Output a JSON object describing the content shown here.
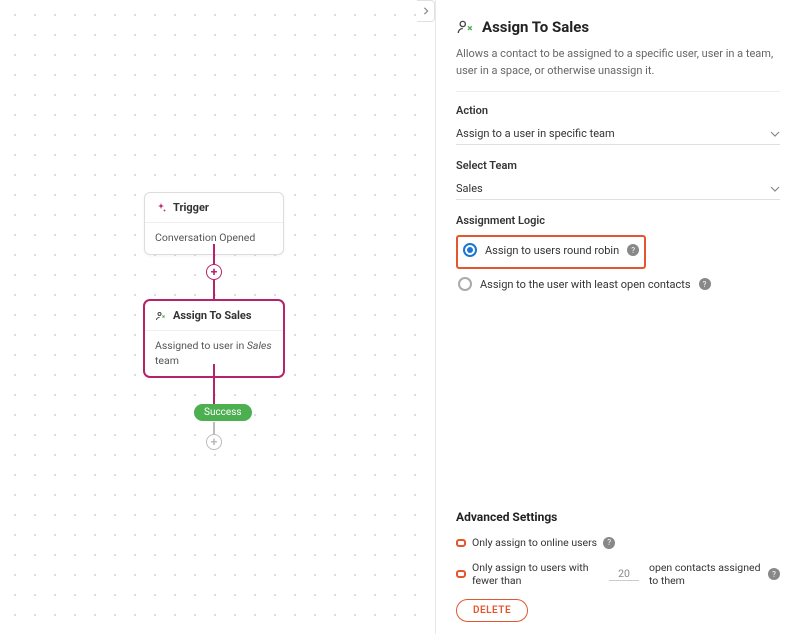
{
  "panel": {
    "title": "Assign To Sales",
    "description": "Allows a contact to be assigned to a specific user, user in a team, user in a space, or otherwise unassign it.",
    "action_label": "Action",
    "action_value": "Assign to a user in specific team",
    "team_label": "Select Team",
    "team_value": "Sales",
    "logic_label": "Assignment Logic",
    "logic_options": {
      "round_robin": "Assign to users round robin",
      "least_open": "Assign to the user with least open contacts"
    },
    "advanced_title": "Advanced Settings",
    "online_only_label": "Only assign to online users",
    "fewer_than_prefix": "Only assign to users with fewer than",
    "fewer_than_value": "20",
    "fewer_than_suffix": "open contacts assigned to them",
    "delete_label": "DELETE"
  },
  "flow": {
    "trigger": {
      "title": "Trigger",
      "body": "Conversation Opened"
    },
    "assign": {
      "title": "Assign To Sales",
      "body_prefix": "Assigned to user in ",
      "body_em": "Sales",
      "body_suffix": " team"
    },
    "success": "Success"
  }
}
